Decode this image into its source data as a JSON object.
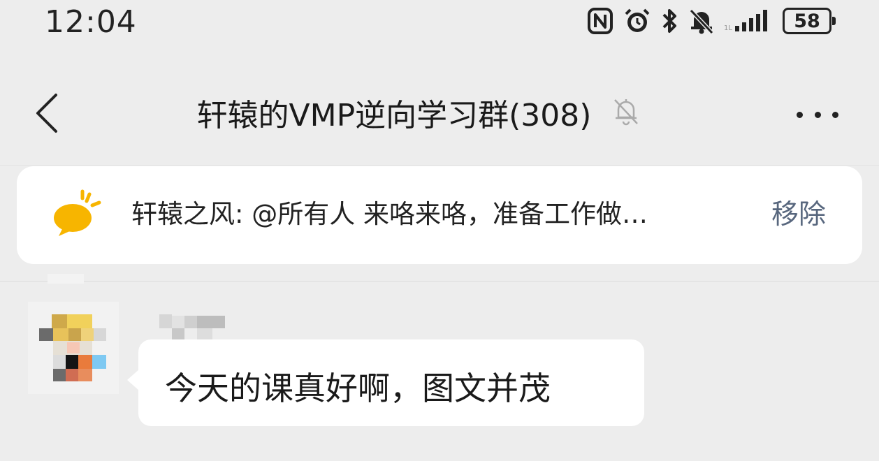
{
  "status_bar": {
    "time": "12:04",
    "battery": "58",
    "icons": [
      "nfc-icon",
      "alarm-icon",
      "bluetooth-icon",
      "mute-bell-icon",
      "signal-icon",
      "battery-icon"
    ]
  },
  "header": {
    "title": "轩辕的VMP逆向学习群(308)",
    "icons": [
      "back-arrow-icon",
      "muted-bell-icon",
      "more-dots-icon"
    ]
  },
  "pinned": {
    "text": "轩辕之风: @所有人 来咯来咯，准备工作做…",
    "remove_label": "移除",
    "icon": "chat-bubble-icon",
    "icon_color": "#f7b500"
  },
  "messages": [
    {
      "sender": "",
      "text": "今天的课真好啊，图文并茂"
    }
  ],
  "colors": {
    "background": "#ededed",
    "bubble": "#ffffff",
    "link": "#58677e"
  }
}
